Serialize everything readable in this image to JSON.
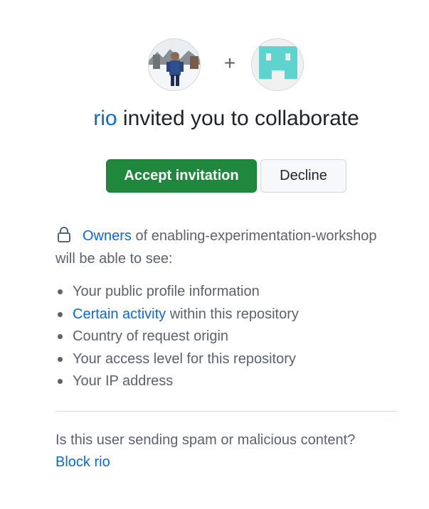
{
  "header": {
    "plus_sign": "+",
    "inviter_username": "rio",
    "invite_text": "invited you to collaborate"
  },
  "actions": {
    "accept_label": "Accept invitation",
    "decline_label": "Decline"
  },
  "visibility": {
    "owners_link": "Owners",
    "statement": "of enabling-experimentation-workshop will be able to see:"
  },
  "permissions": [
    {
      "link": "",
      "text": "Your public profile information"
    },
    {
      "link": "Certain activity",
      "text": "within this repository"
    },
    {
      "link": "",
      "text": "Country of request origin"
    },
    {
      "link": "",
      "text": "Your access level for this repository"
    },
    {
      "link": "",
      "text": "Your IP address"
    }
  ],
  "spam": {
    "question": "Is this user sending spam or malicious content?",
    "block_link": "Block rio"
  },
  "colors": {
    "accent": "#0969da",
    "accept_bg": "#1f883d",
    "muted_text": "#59636e",
    "repo_avatar_teal": "#5fd4cf"
  }
}
